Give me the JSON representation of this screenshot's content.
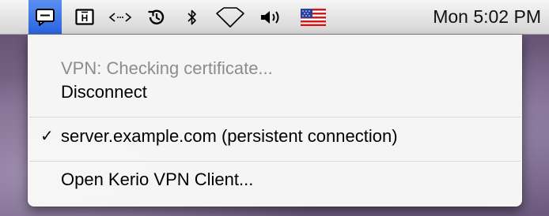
{
  "menubar": {
    "extras": [
      {
        "icon": "vpn-chat-bubble-icon",
        "active": true
      },
      {
        "icon": "ichat-status-icon"
      },
      {
        "icon": "network-arrows-icon"
      },
      {
        "icon": "time-machine-icon"
      },
      {
        "icon": "bluetooth-icon"
      },
      {
        "icon": "airport-wifi-icon"
      },
      {
        "icon": "volume-icon"
      },
      {
        "icon": "us-flag-input-icon"
      }
    ],
    "clock": "Mon 5:02 PM"
  },
  "vpn_menu": {
    "status": "VPN: Checking certificate...",
    "disconnect": "Disconnect",
    "server_check": "✓",
    "server": "server.example.com (persistent connection)",
    "open_client": "Open Kerio VPN Client..."
  },
  "colors": {
    "highlight": "#2a63e0",
    "disabled_text": "#8c8c8c"
  }
}
